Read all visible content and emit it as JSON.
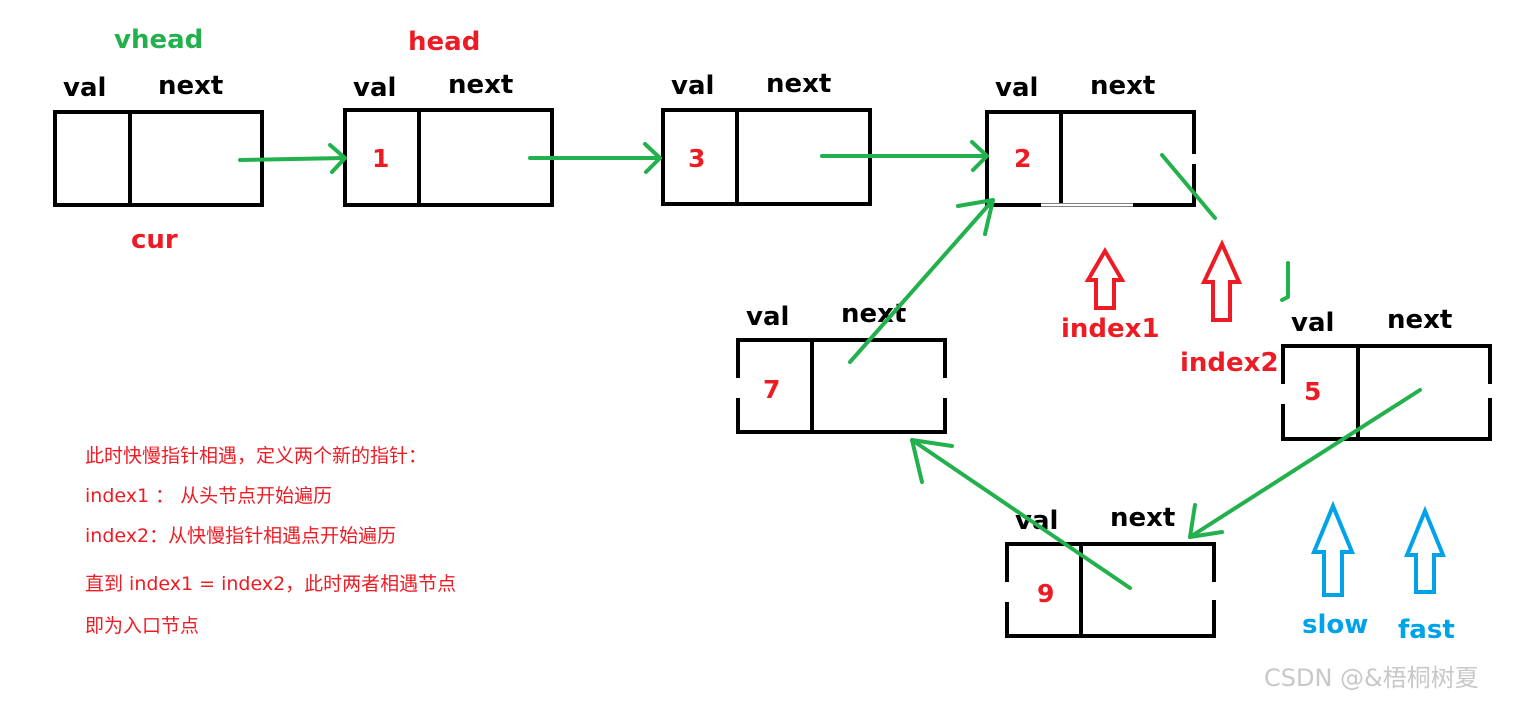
{
  "colors": {
    "arrow": "#22b14c",
    "value": "#ed1c24",
    "vhead_label": "#22b14c",
    "slow_fast": "#00a2e8",
    "box": "#000000"
  },
  "field_labels": {
    "val": "val",
    "next": "next"
  },
  "nodes": {
    "vhead": {
      "value": ""
    },
    "n1": {
      "value": "1"
    },
    "n3": {
      "value": "3"
    },
    "n2": {
      "value": "2"
    },
    "n5": {
      "value": "5"
    },
    "n9": {
      "value": "9"
    },
    "n7": {
      "value": "7"
    }
  },
  "pointers": {
    "vhead": "vhead",
    "head": "head",
    "cur": "cur",
    "index1": "index1",
    "index2": "index2",
    "slow": "slow",
    "fast": "fast"
  },
  "notes": [
    "此时快慢指针相遇，定义两个新的指针：",
    "index1 ： 从头节点开始遍历",
    "index2：从快慢指针相遇点开始遍历",
    "直到 index1 = index2，此时两者相遇节点",
    "即为入口节点"
  ],
  "watermark": "CSDN @&梧桐树夏"
}
